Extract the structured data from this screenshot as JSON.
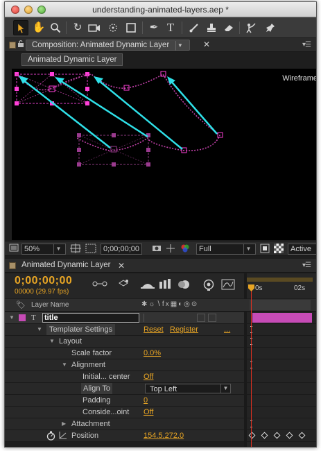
{
  "window": {
    "title": "understanding-animated-layers.aep *"
  },
  "toolbar": {
    "tools": [
      "selection-tool",
      "hand-tool",
      "zoom-tool",
      "rotation-tool",
      "camera-tool",
      "pan-behind-tool",
      "mask-tool",
      "pen-tool",
      "type-tool",
      "brush-tool",
      "clone-stamp-tool",
      "eraser-tool",
      "roto-brush-tool",
      "puppet-pin-tool"
    ]
  },
  "composition_panel": {
    "tab_label": "Composition: Animated Dynamic Layer",
    "layer_button": "Animated Dynamic Layer",
    "viewer_label": "Wireframe"
  },
  "comp_footer": {
    "zoom": "50%",
    "timecode": "0;00;00;00",
    "resolution": "Full",
    "view_button": "Active"
  },
  "timeline_panel": {
    "tab_label": "Animated Dynamic Layer",
    "timecode": "0;00;00;00",
    "frames_fps": "00000 (29.97 fps)",
    "ruler_labels": [
      "0s",
      "02s"
    ],
    "column_header": "Layer Name",
    "colors": {
      "accent": "#e8a524",
      "layer_label": "#c64bb6",
      "playhead": "#e03020"
    }
  },
  "layer_rows": [
    {
      "name": "title",
      "value": ""
    },
    {
      "name": "Templater Settings",
      "value": "Reset",
      "value2": "Register",
      "value3": "..."
    },
    {
      "name": "Layout",
      "value": ""
    },
    {
      "name": "Scale factor",
      "value": "0.0%"
    },
    {
      "name": "Alignment",
      "value": ""
    },
    {
      "name": "Initial... center",
      "value": "Off"
    },
    {
      "name": "Align To",
      "value": "Top Left"
    },
    {
      "name": "Padding",
      "value": "0"
    },
    {
      "name": "Conside...oint",
      "value": "Off"
    },
    {
      "name": "Attachment",
      "value": ""
    },
    {
      "name": "Position",
      "value": "154.5,272.0"
    }
  ]
}
